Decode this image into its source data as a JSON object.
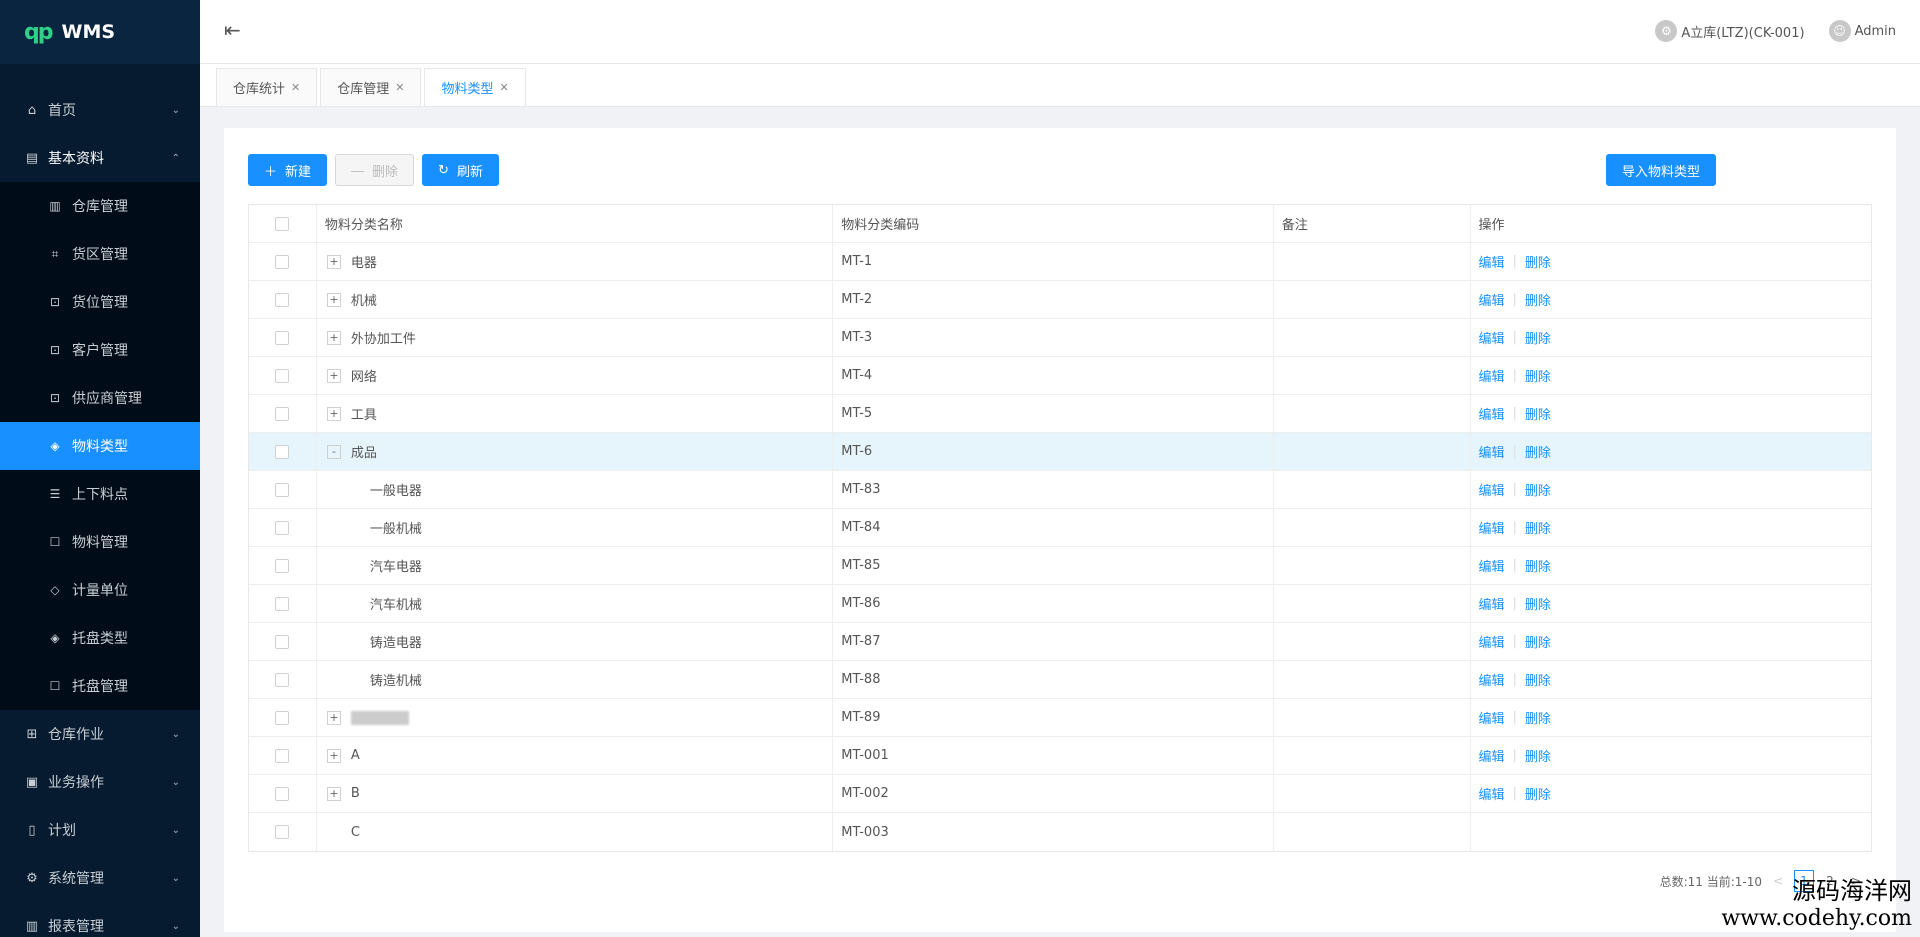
{
  "app": {
    "logo_mark": "qp",
    "logo_text": "WMS"
  },
  "sidebar": {
    "items": [
      {
        "label": "首页",
        "icon": "home-icon",
        "glyph": "⌂",
        "expanded": false
      },
      {
        "label": "基本资料",
        "icon": "profile-icon",
        "glyph": "▤",
        "expanded": true,
        "children": [
          {
            "label": "仓库管理",
            "icon": "warehouse-icon",
            "glyph": "▥",
            "active": false
          },
          {
            "label": "货区管理",
            "icon": "area-icon",
            "glyph": "⌗",
            "active": false
          },
          {
            "label": "货位管理",
            "icon": "location-icon",
            "glyph": "⊡",
            "active": false
          },
          {
            "label": "客户管理",
            "icon": "customer-icon",
            "glyph": "⊡",
            "active": false
          },
          {
            "label": "供应商管理",
            "icon": "supplier-icon",
            "glyph": "⊡",
            "active": false
          },
          {
            "label": "物料类型",
            "icon": "tag-icon",
            "glyph": "◈",
            "active": true
          },
          {
            "label": "上下料点",
            "icon": "point-icon",
            "glyph": "☰",
            "active": false
          },
          {
            "label": "物料管理",
            "icon": "material-icon",
            "glyph": "☐",
            "active": false
          },
          {
            "label": "计量单位",
            "icon": "unit-icon",
            "glyph": "◇",
            "active": false
          },
          {
            "label": "托盘类型",
            "icon": "pallet-type-icon",
            "glyph": "◈",
            "active": false
          },
          {
            "label": "托盘管理",
            "icon": "pallet-icon",
            "glyph": "☐",
            "active": false
          }
        ]
      },
      {
        "label": "仓库作业",
        "icon": "grid-icon",
        "glyph": "⊞",
        "expanded": false
      },
      {
        "label": "业务操作",
        "icon": "doc-check-icon",
        "glyph": "▣",
        "expanded": false
      },
      {
        "label": "计划",
        "icon": "file-icon",
        "glyph": "▯",
        "expanded": false
      },
      {
        "label": "系统管理",
        "icon": "gear-icon",
        "glyph": "⚙",
        "expanded": false
      },
      {
        "label": "报表管理",
        "icon": "chart-icon",
        "glyph": "▥",
        "expanded": false
      }
    ]
  },
  "header": {
    "warehouse": "A立库(LTZ)(CK-001)",
    "user": "Admin"
  },
  "tabs": [
    {
      "label": "仓库统计",
      "active": false
    },
    {
      "label": "仓库管理",
      "active": false
    },
    {
      "label": "物料类型",
      "active": true
    }
  ],
  "toolbar": {
    "new_label": "新建",
    "delete_label": "删除",
    "refresh_label": "刷新",
    "import_label": "导入物料类型"
  },
  "table": {
    "columns": [
      "物料分类名称",
      "物料分类编码",
      "备注",
      "操作"
    ],
    "edit_label": "编辑",
    "delete_label": "删除",
    "rows": [
      {
        "name": "电器",
        "code": "MT-1",
        "note": "",
        "expander": "+",
        "level": 0,
        "ops": true
      },
      {
        "name": "机械",
        "code": "MT-2",
        "note": "",
        "expander": "+",
        "level": 0,
        "ops": true
      },
      {
        "name": "外协加工件",
        "code": "MT-3",
        "note": "",
        "expander": "+",
        "level": 0,
        "ops": true
      },
      {
        "name": "网络",
        "code": "MT-4",
        "note": "",
        "expander": "+",
        "level": 0,
        "ops": true
      },
      {
        "name": "工具",
        "code": "MT-5",
        "note": "",
        "expander": "+",
        "level": 0,
        "ops": true
      },
      {
        "name": "成品",
        "code": "MT-6",
        "note": "",
        "expander": "-",
        "level": 0,
        "ops": true,
        "highlight": true
      },
      {
        "name": "一般电器",
        "code": "MT-83",
        "note": "",
        "expander": "",
        "level": 1,
        "ops": true
      },
      {
        "name": "一般机械",
        "code": "MT-84",
        "note": "",
        "expander": "",
        "level": 1,
        "ops": true
      },
      {
        "name": "汽车电器",
        "code": "MT-85",
        "note": "",
        "expander": "",
        "level": 1,
        "ops": true
      },
      {
        "name": "汽车机械",
        "code": "MT-86",
        "note": "",
        "expander": "",
        "level": 1,
        "ops": true
      },
      {
        "name": "铸造电器",
        "code": "MT-87",
        "note": "",
        "expander": "",
        "level": 1,
        "ops": true
      },
      {
        "name": "铸造机械",
        "code": "MT-88",
        "note": "",
        "expander": "",
        "level": 1,
        "ops": true
      },
      {
        "name": "",
        "code": "MT-89",
        "note": "",
        "expander": "+",
        "level": 0,
        "ops": true,
        "blurred": true
      },
      {
        "name": "A",
        "code": "MT-001",
        "note": "",
        "expander": "+",
        "level": 0,
        "ops": true
      },
      {
        "name": "B",
        "code": "MT-002",
        "note": "",
        "expander": "+",
        "level": 0,
        "ops": true
      },
      {
        "name": "C",
        "code": "MT-003",
        "note": "",
        "expander": "",
        "level": 0,
        "ops": false
      }
    ]
  },
  "pagination": {
    "summary": "总数:11 当前:1-10",
    "prev": "<",
    "pages": [
      "1",
      "2"
    ],
    "current": "1",
    "next": ">"
  },
  "watermark": {
    "name": "源码海洋网",
    "url": "www.codehy.com"
  }
}
